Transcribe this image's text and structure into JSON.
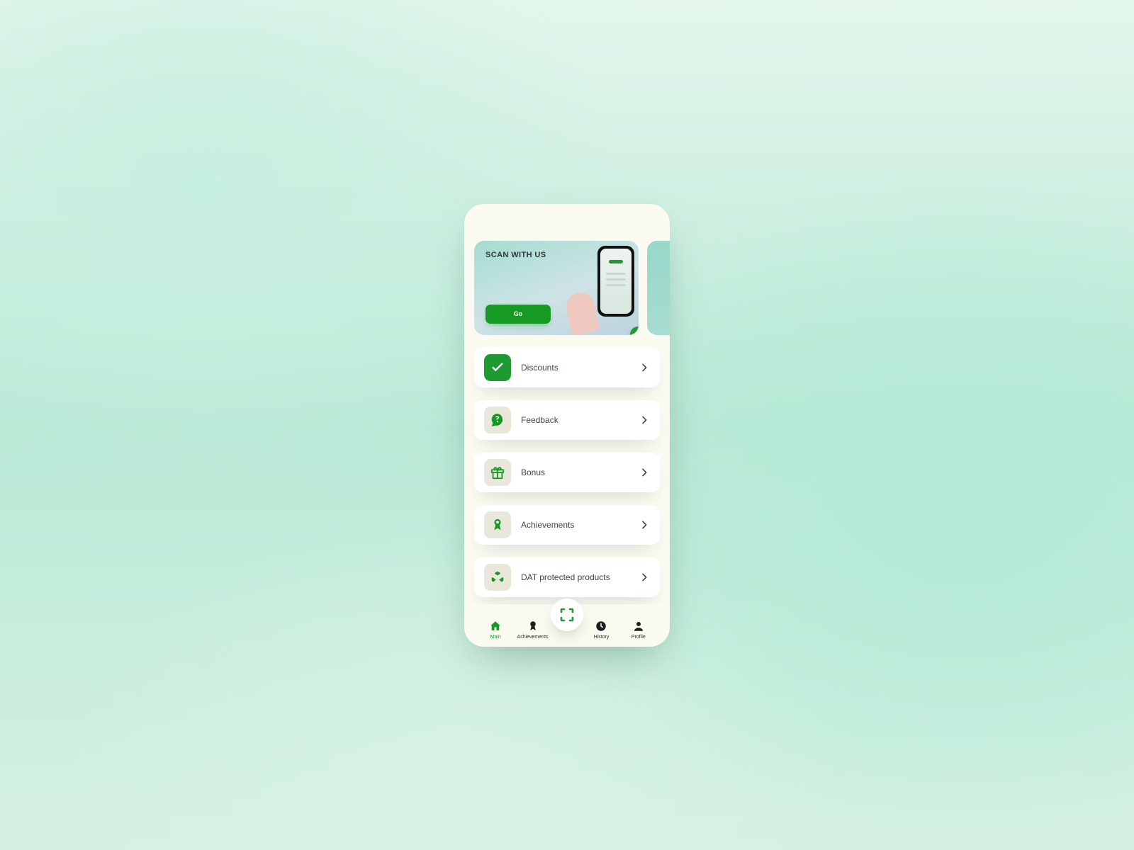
{
  "hero": {
    "title": "SCAN WITH US",
    "cta": "Go"
  },
  "menu": {
    "items": [
      {
        "label": "Discounts"
      },
      {
        "label": "Feedback"
      },
      {
        "label": "Bonus"
      },
      {
        "label": "Achievements"
      },
      {
        "label": "DAT protected products"
      }
    ]
  },
  "nav": {
    "items": [
      {
        "label": "Main"
      },
      {
        "label": "Achievements"
      },
      {
        "label": "History"
      },
      {
        "label": "Profile"
      }
    ]
  }
}
